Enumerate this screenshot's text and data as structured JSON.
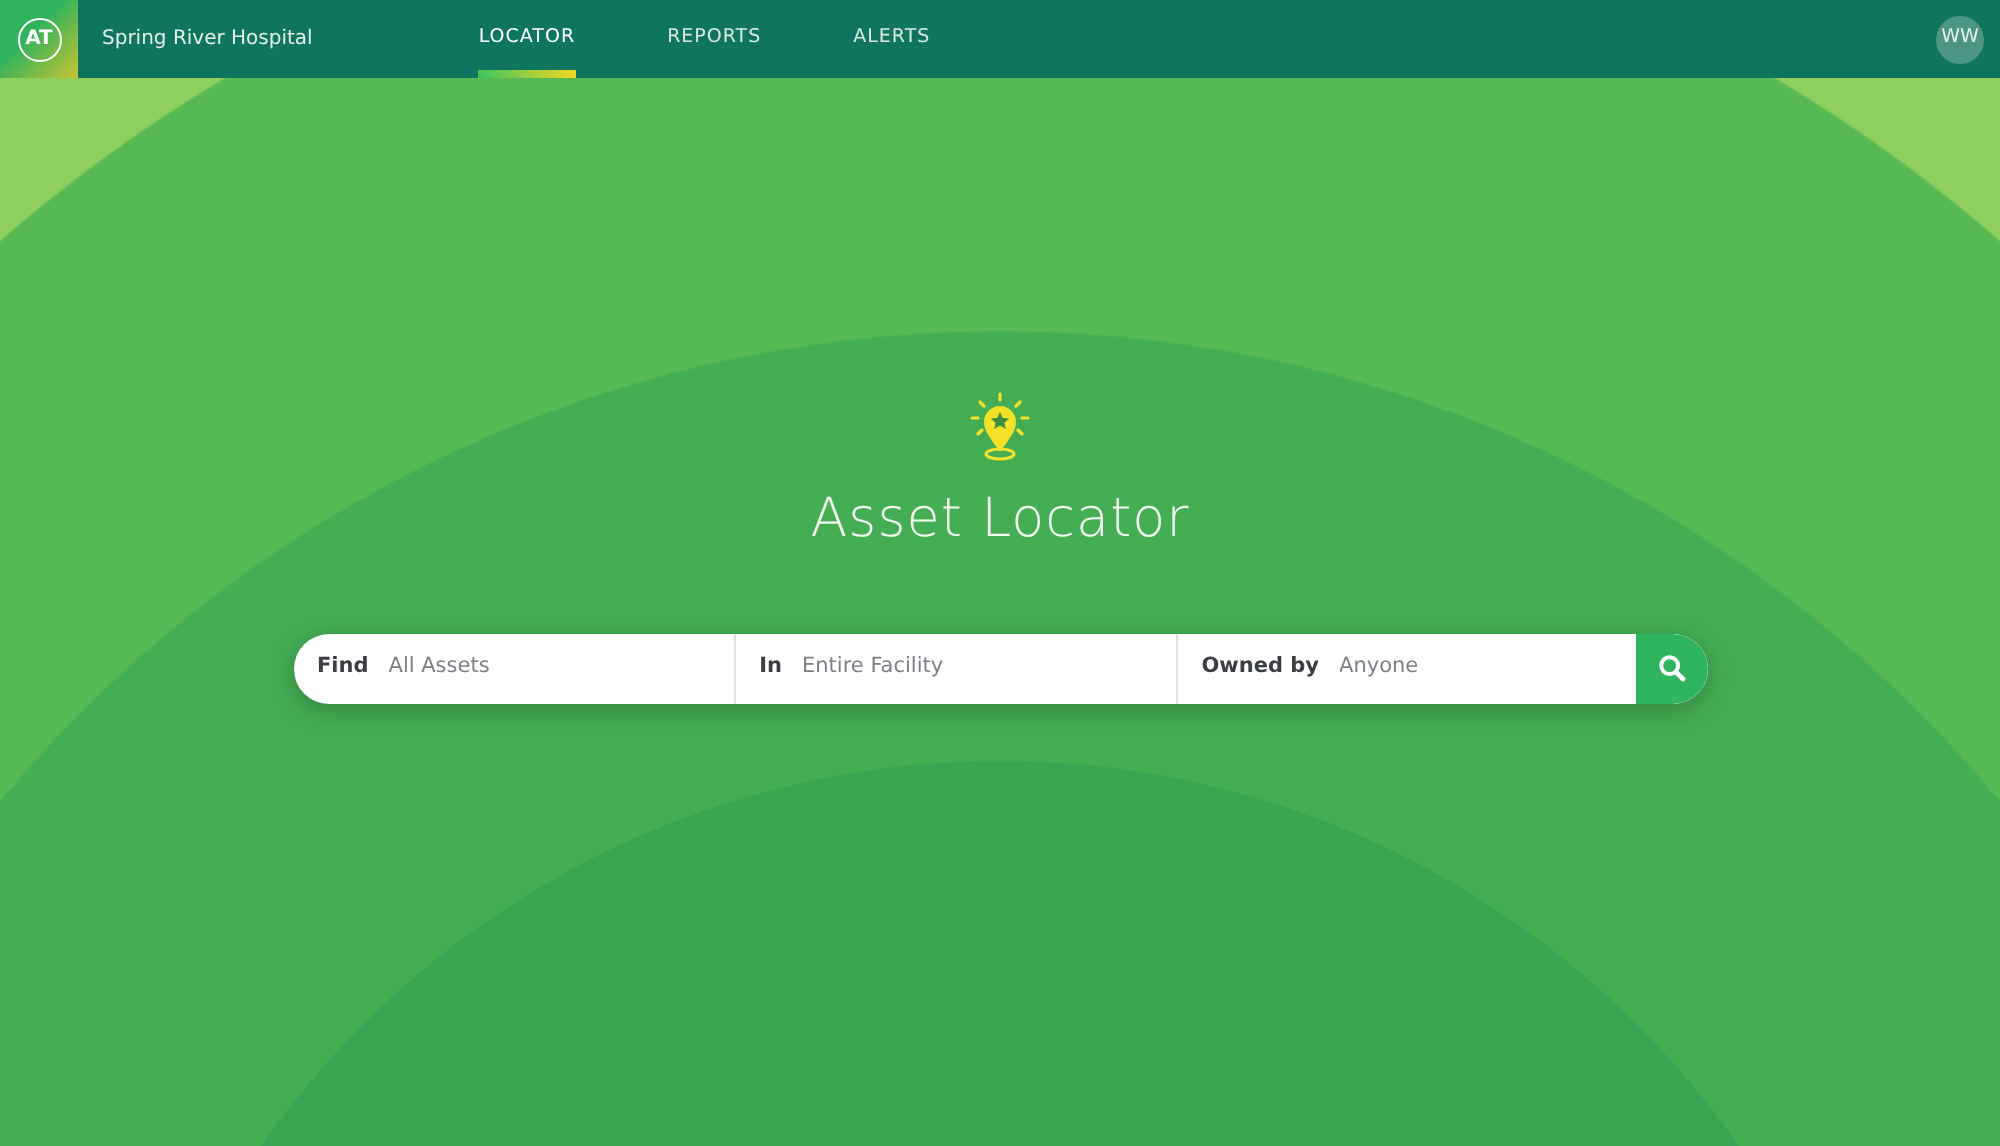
{
  "header": {
    "logo": "AT",
    "hospital": "Spring River Hospital",
    "avatar": "WW"
  },
  "tabs": [
    {
      "label": "LOCATOR",
      "selected": true
    },
    {
      "label": "REPORTS",
      "selected": false
    },
    {
      "label": "ALERTS",
      "selected": false
    }
  ],
  "title": "Asset Locator",
  "search": {
    "fields": [
      {
        "label": "Find",
        "placeholder": "All Assets"
      },
      {
        "label": "In",
        "placeholder": "Entire Facility"
      },
      {
        "label": "Owned by",
        "placeholder": "Anyone"
      }
    ]
  }
}
